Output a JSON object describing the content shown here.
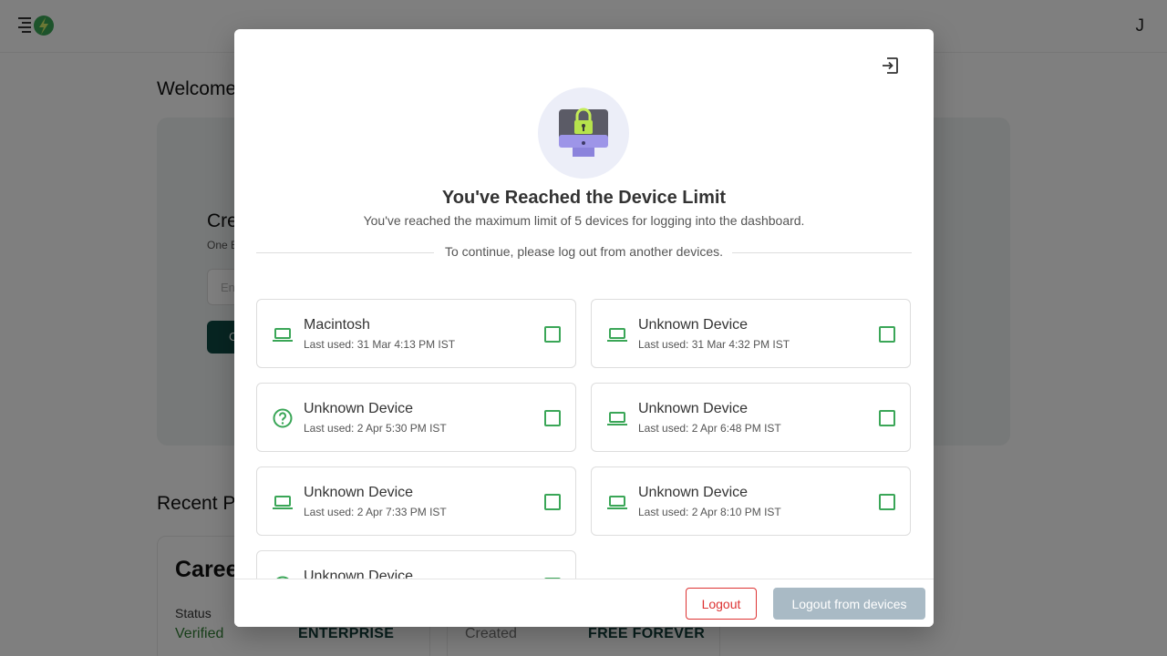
{
  "background": {
    "user_initial": "J",
    "welcome_text": "Welcome",
    "hero": {
      "title": "Cre",
      "subtitle": "One E",
      "input_placeholder": "En",
      "button_label": "C"
    },
    "recent_title": "Recent P",
    "projects": [
      {
        "name": "Caree",
        "status_label": "Status",
        "status": "Verified",
        "plan": "ENTERPRISE"
      },
      {
        "created_label": "Created",
        "plan": "FREE FOREVER"
      }
    ]
  },
  "modal": {
    "title": "You've Reached the Device Limit",
    "description": "You've reached the maximum limit of 5 devices for logging into the dashboard.",
    "divider_text": "To continue, please log out from another devices.",
    "devices": [
      {
        "icon": "laptop-icon",
        "name": "Macintosh",
        "last_used": "Last used: 31 Mar 4:13 PM IST",
        "checked": false
      },
      {
        "icon": "laptop-icon",
        "name": "Unknown Device",
        "last_used": "Last used: 31 Mar 4:32 PM IST",
        "checked": false
      },
      {
        "icon": "question-icon",
        "name": "Unknown Device",
        "last_used": "Last used: 2 Apr 5:30 PM IST",
        "checked": false
      },
      {
        "icon": "laptop-icon",
        "name": "Unknown Device",
        "last_used": "Last used: 2 Apr 6:48 PM IST",
        "checked": false
      },
      {
        "icon": "laptop-icon",
        "name": "Unknown Device",
        "last_used": "Last used: 2 Apr 7:33 PM IST",
        "checked": false
      },
      {
        "icon": "laptop-icon",
        "name": "Unknown Device",
        "last_used": "Last used: 2 Apr 8:10 PM IST",
        "checked": false
      },
      {
        "icon": "question-icon",
        "name": "Unknown Device",
        "last_used": "",
        "checked": false
      }
    ],
    "footer": {
      "logout_label": "Logout",
      "logout_devices_label": "Logout from devices"
    }
  },
  "colors": {
    "accent_green": "#3aa657",
    "danger_red": "#dd3333",
    "disabled_button": "#a9bac5",
    "brand_dark_teal": "#0f4a45"
  }
}
